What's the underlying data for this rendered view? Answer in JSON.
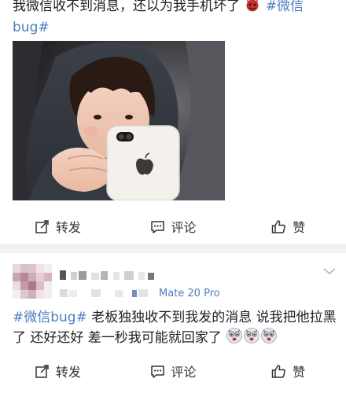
{
  "post1": {
    "text_main": "我微信收不到消息，还以为我手机坏了",
    "text_topic": "#微信bug#",
    "emoji": "devil-emoji",
    "photo": "child-holding-white-iphone",
    "actions": [
      {
        "label": "转发",
        "icon": "repost-icon"
      },
      {
        "label": "评论",
        "icon": "comment-icon"
      },
      {
        "label": "赞",
        "icon": "like-icon"
      }
    ]
  },
  "post2": {
    "author_name": "",
    "device": "Mate 20 Pro",
    "text_topic": "#微信bug#",
    "text_main": " 老板独独收不到我发的消息  说我把他拉黑了  还好还好 差一秒我可能就回家了",
    "emoji_trailing": "scared-face-emoji ×3",
    "actions": [
      {
        "label": "转发",
        "icon": "repost-icon"
      },
      {
        "label": "评论",
        "icon": "comment-icon"
      },
      {
        "label": "赞",
        "icon": "like-icon"
      }
    ]
  },
  "colors": {
    "topic": "#4f7dbf",
    "text": "#1f1f1f",
    "separator": "#f2f2f2"
  }
}
